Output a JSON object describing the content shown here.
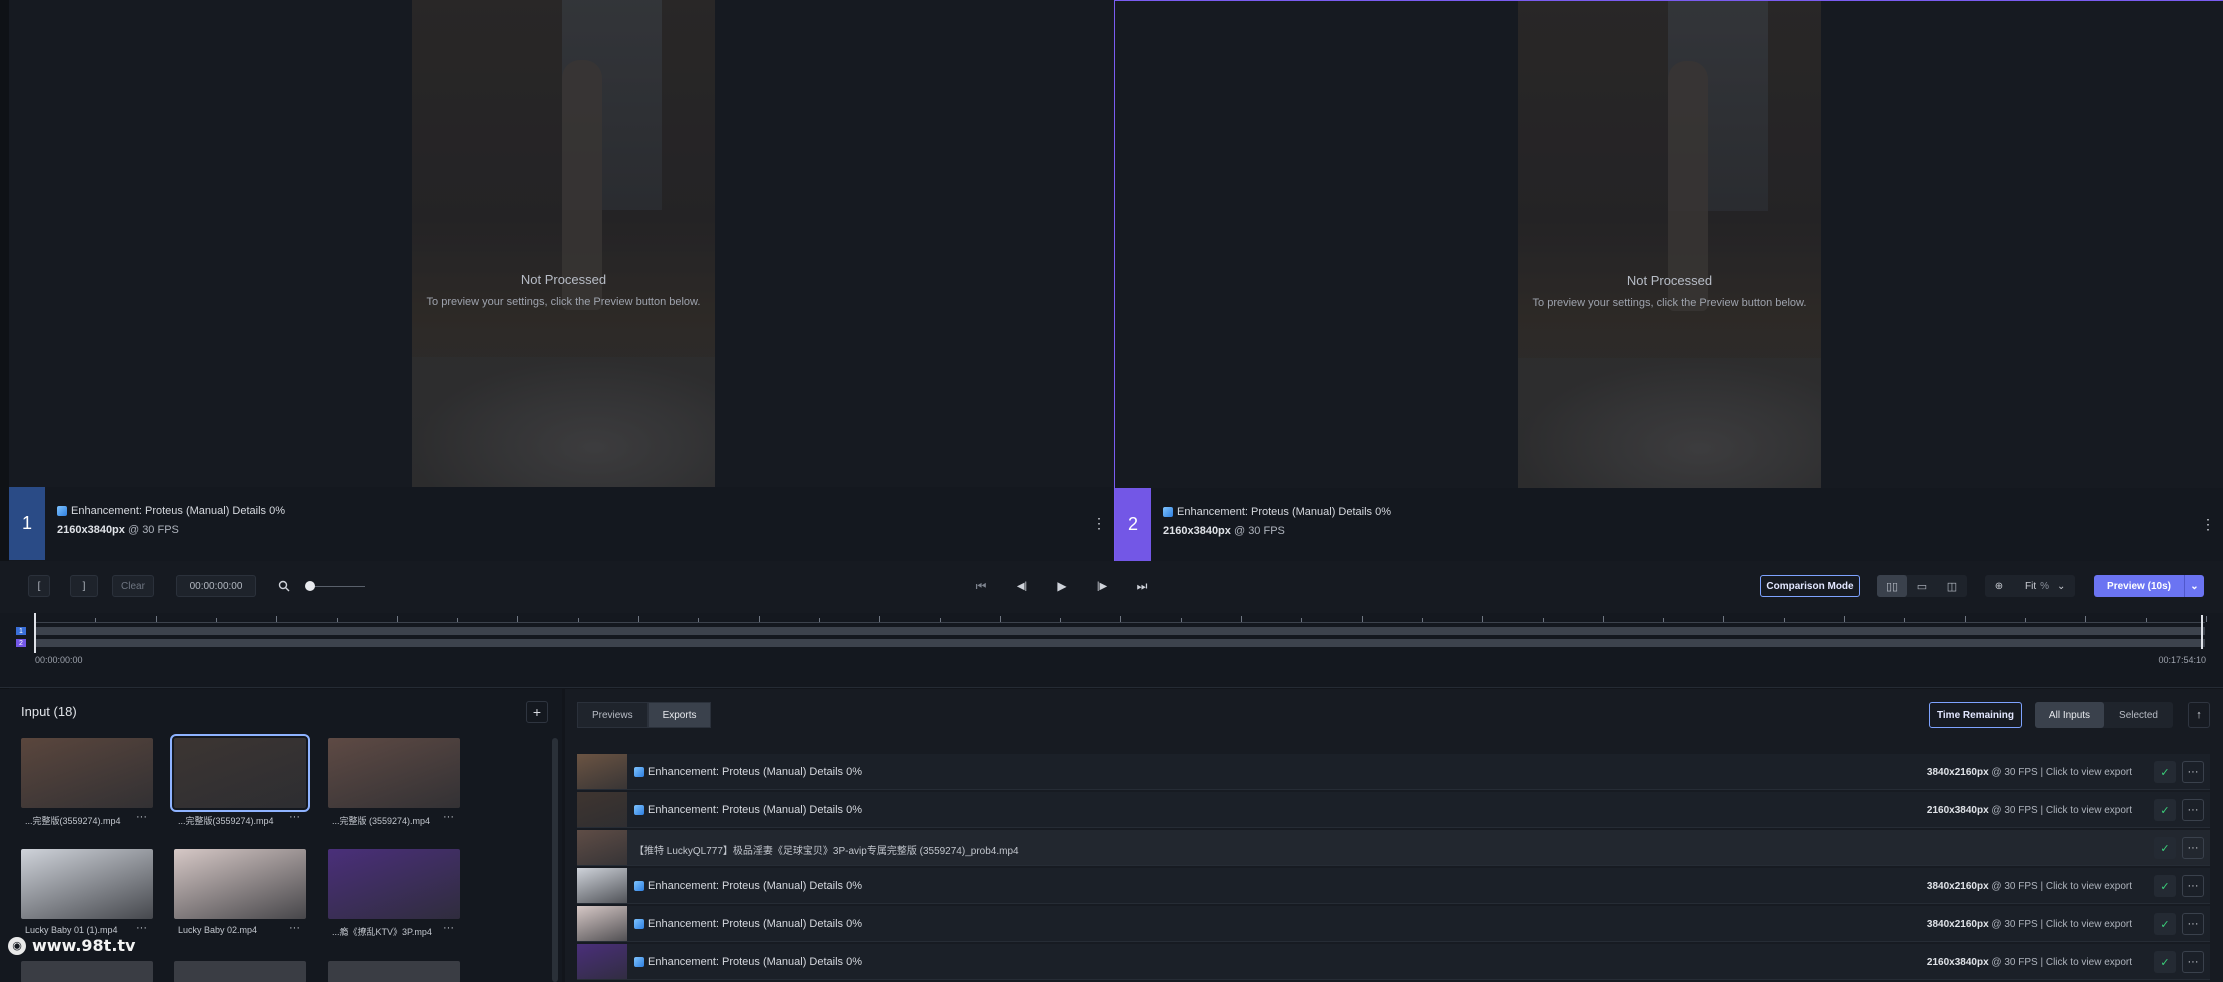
{
  "panes": [
    {
      "number": "1",
      "not_processed_title": "Not Processed",
      "not_processed_sub": "To preview your settings, click the Preview button below.",
      "enhancement": "Enhancement: Proteus (Manual) Details 0%",
      "resolution": "2160x3840px",
      "fps": "@ 30 FPS",
      "menu": "⋮"
    },
    {
      "number": "2",
      "not_processed_title": "Not Processed",
      "not_processed_sub": "To preview your settings, click the Preview button below.",
      "enhancement": "Enhancement: Proteus (Manual) Details 0%",
      "resolution": "2160x3840px",
      "fps": "@ 30 FPS",
      "menu": "⋮"
    }
  ],
  "transport": {
    "mark_in": "[",
    "mark_out": "]",
    "clear": "Clear",
    "timecode": "00:00:00:00",
    "zoom_icon": "search-icon",
    "first_frame": "⏮",
    "prev_frame": "◀|",
    "play": "▶",
    "next_frame": "|▶",
    "last_frame": "⏭",
    "comparison_mode": "Comparison Mode",
    "zoom_fit": "Fit",
    "zoom_unit": "%",
    "preview_button": "Preview (10s)"
  },
  "timeline": {
    "start_time": "00:00:00:00",
    "end_time": "00:17:54:10",
    "track_labels": [
      "1",
      "2"
    ]
  },
  "input": {
    "title": "Input (18)",
    "add": "+",
    "items": [
      {
        "name": "...完整版(3559274).mp4",
        "color": "#5a463d",
        "selected": false
      },
      {
        "name": "...完整版(3559274).mp4",
        "color": "#3c3532",
        "selected": true
      },
      {
        "name": "...完整版 (3559274).mp4",
        "color": "#5e4a44",
        "selected": false
      },
      {
        "name": "Lucky Baby 01 (1).mp4",
        "color": "#cfd3da",
        "selected": false
      },
      {
        "name": "Lucky Baby 02.mp4",
        "color": "#d6c8c6",
        "selected": false
      },
      {
        "name": "...瘾《撩乱KTV》3P.mp4",
        "color": "#4a2f7a",
        "selected": false
      }
    ],
    "more": "···",
    "watermark": "www.98t.tv"
  },
  "exports": {
    "tabs": [
      "Previews",
      "Exports"
    ],
    "active_tab": "Exports",
    "time_remaining": "Time Remaining",
    "filter": [
      "All Inputs",
      "Selected"
    ],
    "sort": "↑",
    "click_hint": "| Click to view export",
    "rows": [
      {
        "title": "Enhancement: Proteus (Manual) Details 0%",
        "res": "3840x2160px",
        "fps": "@ 30 FPS",
        "thumb": "#6b5443",
        "plain": false
      },
      {
        "title": "Enhancement: Proteus (Manual) Details 0%",
        "res": "2160x3840px",
        "fps": "@ 30 FPS",
        "thumb": "#3f3530",
        "plain": false
      },
      {
        "title": "【推特 LuckyQL777】极品淫妻《足球宝贝》3P-avip专属完整版 (3559274)_prob4.mp4",
        "res": "",
        "fps": "",
        "thumb": "#5f4d46",
        "plain": true
      },
      {
        "title": "Enhancement: Proteus (Manual) Details 0%",
        "res": "3840x2160px",
        "fps": "@ 30 FPS",
        "thumb": "#cfd3da",
        "plain": false
      },
      {
        "title": "Enhancement: Proteus (Manual) Details 0%",
        "res": "3840x2160px",
        "fps": "@ 30 FPS",
        "thumb": "#d6c8c6",
        "plain": false
      },
      {
        "title": "Enhancement: Proteus (Manual) Details 0%",
        "res": "2160x3840px",
        "fps": "@ 30 FPS",
        "thumb": "#4a2f7a",
        "plain": false
      }
    ]
  },
  "colors": {
    "accent": "#6b74f2",
    "pane2_border": "#7a5cf0",
    "check": "#3ad07a"
  }
}
